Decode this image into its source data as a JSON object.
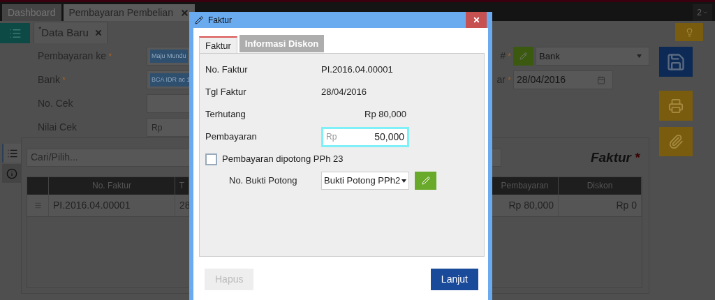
{
  "top_tabs": [
    {
      "label": "Dashboard",
      "selected": false,
      "closable": false
    },
    {
      "label": "Pembayaran Pembelian",
      "selected": true,
      "closable": true
    }
  ],
  "window_count": "2",
  "doc_tab": {
    "label": "Data Baru",
    "modified_mark": "*",
    "selected": true
  },
  "form": {
    "left_fields": [
      {
        "label": "Pembayaran ke",
        "required_mark": "*",
        "kind": "tag",
        "value": "Maju Mundu"
      },
      {
        "label": "Bank",
        "required_mark": "*",
        "kind": "tag",
        "value": "BCA IDR ac 1"
      },
      {
        "label": "No. Cek",
        "kind": "text"
      },
      {
        "label": "Nilai Cek",
        "kind": "text",
        "placeholder": "Rp"
      }
    ],
    "right_fields": [
      {
        "label": "#",
        "required_mark": "*",
        "kind": "select",
        "value": "Bank"
      },
      {
        "label": "ar",
        "required_mark": "*",
        "kind": "date",
        "value": "28/04/2016"
      }
    ]
  },
  "side_tabs": [
    {
      "kind": "list",
      "selected": true
    },
    {
      "kind": "info",
      "selected": false
    }
  ],
  "invoice_panel": {
    "search_placeholder": "Cari/Pilih...",
    "title": "Faktur",
    "title_mark": "*",
    "columns": [
      "No. Faktur",
      "T",
      "Pembayaran",
      "Diskon"
    ],
    "rows": [
      {
        "cells": [
          "PI.2016.04.00001",
          "28",
          "Rp 80,000",
          "Rp 0"
        ]
      }
    ]
  },
  "dialog": {
    "title": "Faktur",
    "tabs": [
      {
        "label": "Faktur",
        "selected": true
      },
      {
        "label": "Informasi Diskon",
        "selected": false
      }
    ],
    "fields": [
      {
        "label": "No. Faktur",
        "kind": "text",
        "value": "PI.2016.04.00001"
      },
      {
        "label": "Tgl Faktur",
        "kind": "text",
        "value": "28/04/2016"
      },
      {
        "label": "Terhutang",
        "kind": "amount",
        "value": "Rp 80,000"
      },
      {
        "label": "Pembayaran",
        "kind": "input",
        "prefix": "Rp",
        "value": "50,000",
        "focused": true
      }
    ],
    "pph": {
      "label": "Pembayaran dipotong PPh 23",
      "checked": false
    },
    "bukti": {
      "label": "No. Bukti Potong",
      "value": "Bukti Potong PPh2"
    },
    "buttons": [
      {
        "label": "Hapus",
        "disabled": true
      },
      {
        "label": "Lanjut",
        "disabled": false
      }
    ]
  }
}
